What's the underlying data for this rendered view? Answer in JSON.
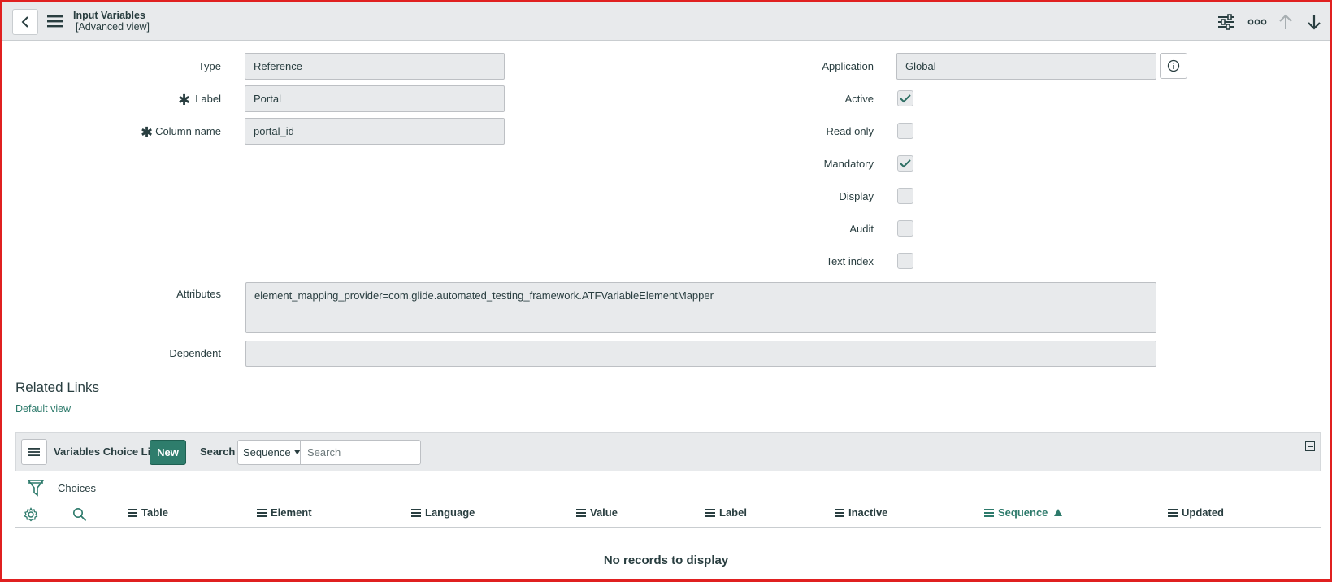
{
  "header": {
    "title": "Input Variables",
    "subtitle": "[Advanced view]",
    "icons": [
      "back-icon",
      "menu-icon",
      "settings-sliders-icon",
      "more-icon",
      "arrow-up-icon",
      "arrow-down-icon"
    ]
  },
  "form": {
    "type": {
      "label": "Type",
      "value": "Reference"
    },
    "label_field": {
      "label": "Label",
      "value": "Portal"
    },
    "column_name": {
      "label": "Column name",
      "value": "portal_id"
    },
    "application": {
      "label": "Application",
      "value": "Global"
    },
    "checkboxes": [
      {
        "label": "Active",
        "checked": true
      },
      {
        "label": "Read only",
        "checked": false
      },
      {
        "label": "Mandatory",
        "checked": true
      },
      {
        "label": "Display",
        "checked": false
      },
      {
        "label": "Audit",
        "checked": false
      },
      {
        "label": "Text index",
        "checked": false
      }
    ],
    "attributes": {
      "label": "Attributes",
      "value": "element_mapping_provider=com.glide.automated_testing_framework.ATFVariableElementMapper"
    },
    "dependent": {
      "label": "Dependent",
      "value": ""
    }
  },
  "related_links": {
    "title": "Related Links",
    "default_view": "Default view"
  },
  "list": {
    "title": "Variables Choice List",
    "new_label": "New",
    "search_label": "Search",
    "search_field": "Sequence",
    "search_placeholder": "Search",
    "filter_label": "Choices",
    "columns": [
      "Table",
      "Element",
      "Language",
      "Value",
      "Label",
      "Inactive",
      "Sequence",
      "Updated"
    ],
    "sorted_column": "Sequence",
    "empty_message": "No records to display"
  },
  "colors": {
    "accent": "#2e7d6c",
    "link": "#2d7a6b",
    "header_bg": "#e8eaec",
    "field_bg": "#e8eaec",
    "frame_border": "#e02020"
  }
}
